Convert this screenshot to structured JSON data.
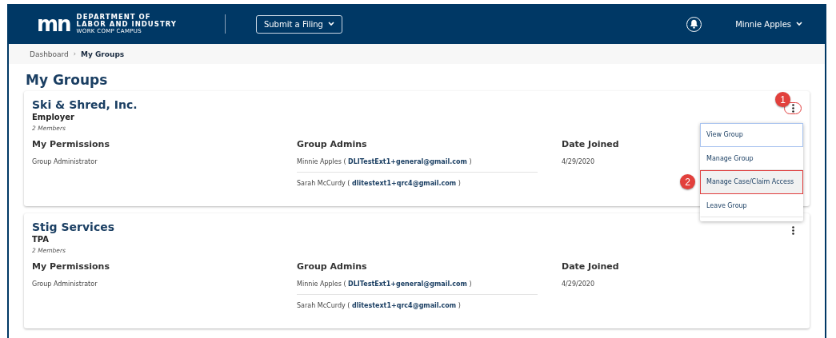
{
  "header": {
    "logo_mark": "mn",
    "logo_line1": "DEPARTMENT OF",
    "logo_line2": "LABOR AND INDUSTRY",
    "logo_line3": "WORK COMP CAMPUS",
    "submit_button": "Submit a Filing",
    "user_name": "Minnie Apples"
  },
  "breadcrumb_separator": "›",
  "breadcrumb": [
    {
      "label": "Dashboard",
      "current": false
    },
    {
      "label": "My Groups",
      "current": true
    }
  ],
  "page_title": "My Groups",
  "groups": [
    {
      "name": "Ski & Shred, Inc.",
      "type": "Employer",
      "members": "2 Members",
      "permissions_heading": "My Permissions",
      "permissions": "Group Administrator",
      "admins_heading": "Group Admins",
      "admins": [
        "Minnie Apples ( **DLITestExt1+general@gmail.com** )",
        "Sarah McCurdy ( **dlitestext1+qrc4@gmail.com** )"
      ],
      "date_heading": "Date Joined",
      "date_joined": "4/29/2020",
      "menu_open": true,
      "menu_highlighted": true,
      "callout": "1",
      "menu_items": [
        {
          "label": "View Group",
          "focused": true,
          "highlighted": false
        },
        {
          "label": "Manage Group",
          "focused": false,
          "highlighted": false
        },
        {
          "label": "Manage Case/Claim Access",
          "focused": false,
          "highlighted": true,
          "callout": "2"
        },
        {
          "label": "Leave Group",
          "focused": false,
          "highlighted": false
        }
      ]
    },
    {
      "name": "Stig Services",
      "type": "TPA",
      "members": "2 Members",
      "permissions_heading": "My Permissions",
      "permissions": "Group Administrator",
      "admins_heading": "Group Admins",
      "admins": [
        "Minnie Apples ( **DLITestExt1+general@gmail.com** )",
        "Sarah McCurdy ( **dlitestext1+qrc4@gmail.com** )"
      ],
      "date_heading": "Date Joined",
      "date_joined": "4/29/2020",
      "menu_open": false,
      "menu_highlighted": false
    }
  ]
}
